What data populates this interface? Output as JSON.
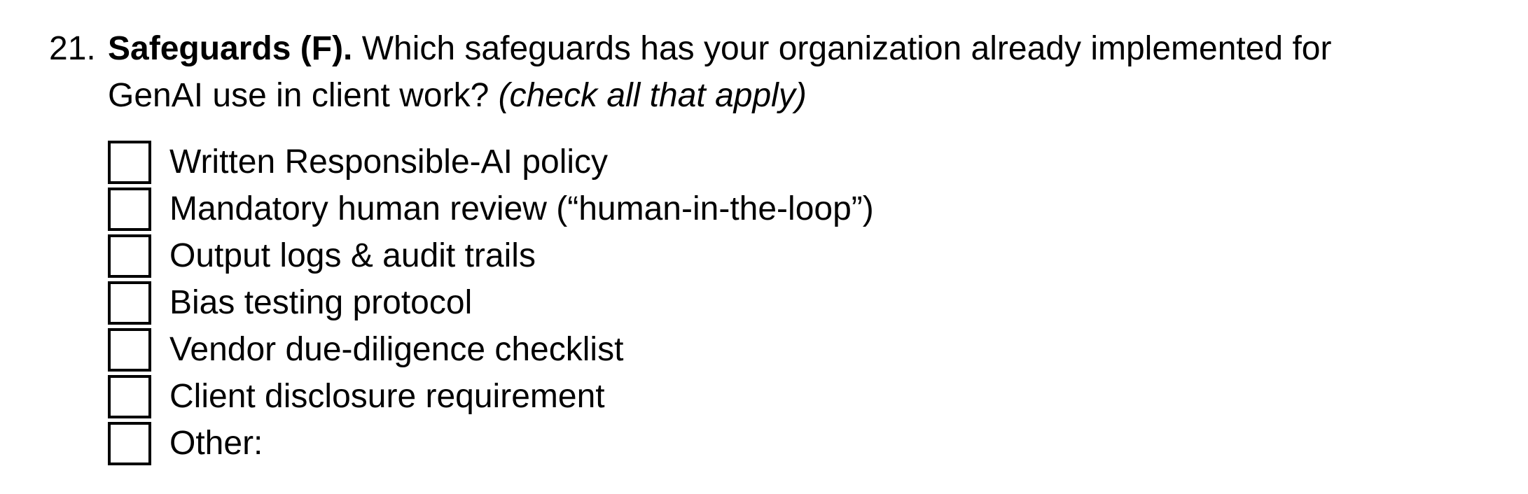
{
  "question": {
    "number": "21.",
    "title": "Safeguards (F).",
    "text_line1": "Which safeguards has your organization already implemented for",
    "text_line2": "GenAI use in client work?",
    "instruction": "(check all that apply)"
  },
  "options": [
    {
      "label": "Written Responsible-AI policy",
      "checked": false
    },
    {
      "label": "Mandatory human review (“human-in-the-loop”)",
      "checked": false
    },
    {
      "label": "Output logs & audit trails",
      "checked": false
    },
    {
      "label": "Bias testing protocol",
      "checked": false
    },
    {
      "label": "Vendor due-diligence checklist",
      "checked": false
    },
    {
      "label": "Client disclosure requirement",
      "checked": false
    },
    {
      "label": "Other:",
      "checked": false
    }
  ]
}
